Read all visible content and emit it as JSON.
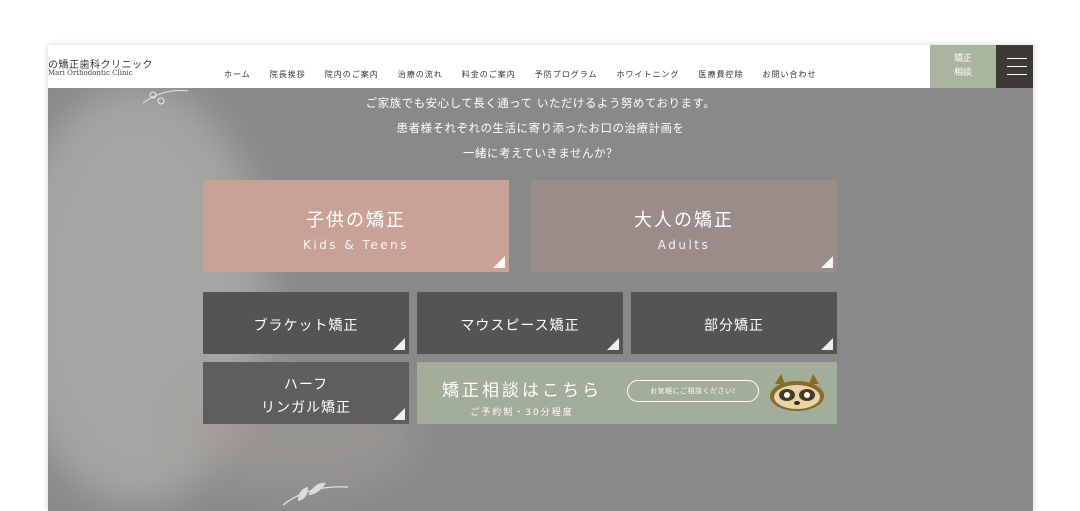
{
  "header": {
    "logo_ja": "の矯正歯科クリニック",
    "logo_en": "Mari Orthodontic Clinic",
    "nav": [
      "ホーム",
      "院長挨拶",
      "院内のご案内",
      "治療の流れ",
      "料金のご案内",
      "予防プログラム",
      "ホワイトニング",
      "医療費控除",
      "お問い合わせ"
    ],
    "consult_line1": "矯正",
    "consult_line2": "相談",
    "menu_icon": "hamburger-menu-icon"
  },
  "intro": {
    "line1": "ご家族でも安心して長く通って いただけるよう努めております。",
    "line2": "患者様それぞれの生活に寄り添ったお口の治療計画を",
    "line3": "一緒に考えていきませんか？"
  },
  "tiles": {
    "kids_ja": "子供の矯正",
    "kids_en": "Kids & Teens",
    "adults_ja": "大人の矯正",
    "adults_en": "Adults",
    "bracket": "ブラケット矯正",
    "mouthpiece": "マウスピース矯正",
    "partial": "部分矯正",
    "half_line1": "ハーフ",
    "half_line2": "リンガル矯正",
    "consult_title": "矯正相談はこちら",
    "consult_sub": "ご予約制・30分程度",
    "consult_bubble": "お気軽にご相談ください!"
  },
  "colors": {
    "kids": "#c9a196",
    "adults": "#9a8c88",
    "dark_tile": "#545454",
    "green": "#a2ad9a",
    "overlay": "#8a8989"
  }
}
